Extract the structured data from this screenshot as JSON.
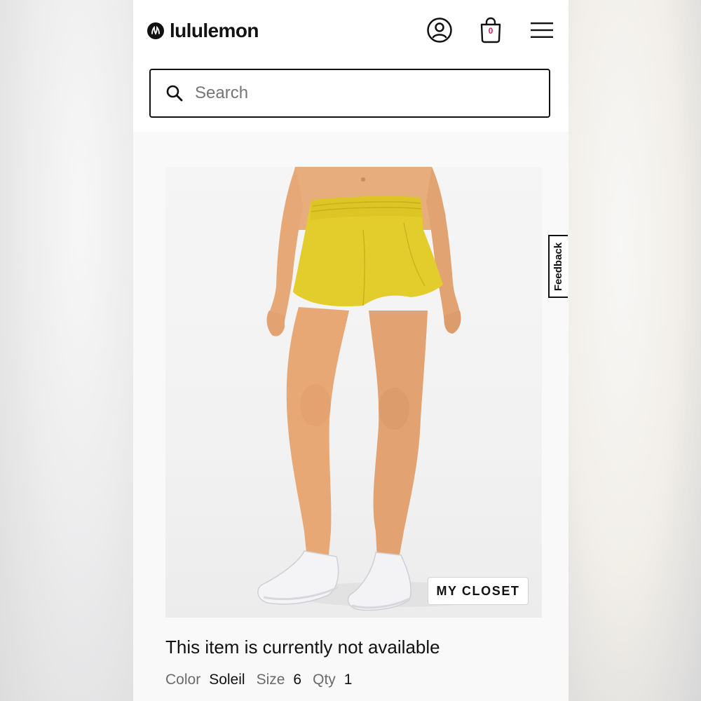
{
  "header": {
    "brand": "lululemon",
    "cart_count": "0",
    "search": {
      "placeholder": "Search",
      "value": ""
    }
  },
  "icons": {
    "logo": "lululemon-logo-icon",
    "account": "user-circle-icon",
    "bag": "shopping-bag-icon",
    "menu": "hamburger-menu-icon",
    "search": "search-icon"
  },
  "product": {
    "my_closet_label": "MY CLOSET",
    "availability": "This item is currently not available",
    "details": [
      {
        "label": "Color",
        "value": "Soleil"
      },
      {
        "label": "Size",
        "value": "6"
      },
      {
        "label": "Qty",
        "value": "1"
      }
    ]
  },
  "feedback_label": "Feedback",
  "colors": {
    "brand_red": "#d6215b",
    "text": "#111111",
    "muted": "#6b6b6b",
    "shorts_yellow": "#e2cd2c"
  }
}
